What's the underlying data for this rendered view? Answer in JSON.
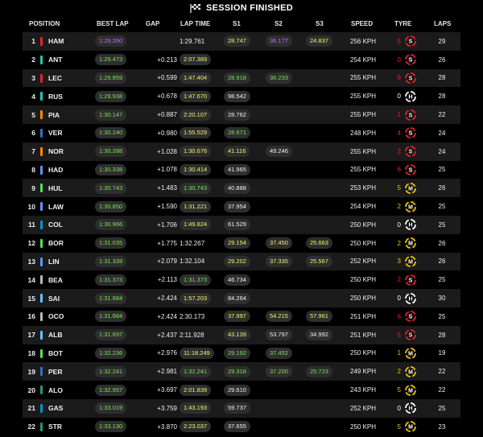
{
  "header": {
    "title": "SESSION FINISHED",
    "icon": "checkered-flag-icon"
  },
  "columns": {
    "position": "POSITION",
    "best_lap": "BEST LAP",
    "gap": "GAP",
    "lap_time": "LAP TIME",
    "s1": "S1",
    "s2": "S2",
    "s3": "S3",
    "speed": "SPEED",
    "tyre": "TYRE",
    "laps": "LAPS"
  },
  "colors": {
    "green": "#7be05a",
    "yellow": "#f3f36b",
    "purple": "#c86cff",
    "white": "#f0f0f0",
    "pill_bg": "#2e2e2e",
    "soft": "#e8202a",
    "medium": "#f2c200",
    "hard": "#ffffff"
  },
  "rows": [
    {
      "pos": "1",
      "driver": "HAM",
      "team_color": "#e8202a",
      "best": "1:29.260",
      "best_c": "purple",
      "gap": "",
      "lap": "1:29.761",
      "lap_c": "white",
      "s1": "28.747",
      "s1_c": "yellow",
      "s2": "36.177",
      "s2_c": "purple",
      "s3": "24.837",
      "s3_c": "yellow",
      "speed": "256 KPH",
      "tyre_age": "5",
      "tyre_age_c": "#e8202a",
      "tyre": "S",
      "laps": "29"
    },
    {
      "pos": "2",
      "driver": "ANT",
      "team_color": "#20c9a9",
      "best": "1:29.473",
      "best_c": "green",
      "gap": "+0.213",
      "lap": "2:07.389",
      "lap_c": "yellow",
      "s1": "",
      "s1_c": "white",
      "s2": "",
      "s2_c": "white",
      "s3": "",
      "s3_c": "white",
      "speed": "254 KPH",
      "tyre_age": "0",
      "tyre_age_c": "#e8202a",
      "tyre": "S",
      "laps": "26"
    },
    {
      "pos": "3",
      "driver": "LEC",
      "team_color": "#e8202a",
      "best": "1:29.859",
      "best_c": "green",
      "gap": "+0.599",
      "lap": "1:47.404",
      "lap_c": "yellow",
      "s1": "28.918",
      "s1_c": "green",
      "s2": "36.233",
      "s2_c": "green",
      "s3": "",
      "s3_c": "white",
      "speed": "255 KPH",
      "tyre_age": "6",
      "tyre_age_c": "#e8202a",
      "tyre": "S",
      "laps": "28"
    },
    {
      "pos": "4",
      "driver": "RUS",
      "team_color": "#20c9a9",
      "best": "1:29.938",
      "best_c": "green",
      "gap": "+0.678",
      "lap": "1:47.670",
      "lap_c": "yellow",
      "s1": "98.542",
      "s1_c": "white",
      "s2": "",
      "s2_c": "white",
      "s3": "",
      "s3_c": "white",
      "speed": "255 KPH",
      "tyre_age": "0",
      "tyre_age_c": "#ffffff",
      "tyre": "H",
      "laps": "28"
    },
    {
      "pos": "5",
      "driver": "PIA",
      "team_color": "#ff8700",
      "best": "1:30.147",
      "best_c": "green",
      "gap": "+0.887",
      "lap": "2:20.107",
      "lap_c": "yellow",
      "s1": "28.762",
      "s1_c": "white",
      "s2": "",
      "s2_c": "white",
      "s3": "",
      "s3_c": "white",
      "speed": "255 KPH",
      "tyre_age": "1",
      "tyre_age_c": "#e8202a",
      "tyre": "S",
      "laps": "22"
    },
    {
      "pos": "6",
      "driver": "VER",
      "team_color": "#3671c6",
      "best": "1:30.240",
      "best_c": "green",
      "gap": "+0.980",
      "lap": "1:55.529",
      "lap_c": "yellow",
      "s1": "28.671",
      "s1_c": "green",
      "s2": "",
      "s2_c": "white",
      "s3": "",
      "s3_c": "white",
      "speed": "248 KPH",
      "tyre_age": "4",
      "tyre_age_c": "#e8202a",
      "tyre": "S",
      "laps": "24"
    },
    {
      "pos": "7",
      "driver": "NOR",
      "team_color": "#ff8700",
      "best": "1:30.288",
      "best_c": "green",
      "gap": "+1.028",
      "lap": "1:30.676",
      "lap_c": "yellow",
      "s1": "41.116",
      "s1_c": "yellow",
      "s2": "49.246",
      "s2_c": "white",
      "s3": "",
      "s3_c": "white",
      "speed": "255 KPH",
      "tyre_age": "2",
      "tyre_age_c": "#e8202a",
      "tyre": "S",
      "laps": "24"
    },
    {
      "pos": "8",
      "driver": "HAD",
      "team_color": "#6692ff",
      "best": "1:30.338",
      "best_c": "green",
      "gap": "+1.078",
      "lap": "1:30.414",
      "lap_c": "yellow",
      "s1": "41.965",
      "s1_c": "white",
      "s2": "",
      "s2_c": "white",
      "s3": "",
      "s3_c": "white",
      "speed": "255 KPH",
      "tyre_age": "6",
      "tyre_age_c": "#e8202a",
      "tyre": "S",
      "laps": "25"
    },
    {
      "pos": "9",
      "driver": "HUL",
      "team_color": "#52e252",
      "best": "1:30.743",
      "best_c": "green",
      "gap": "+1.483",
      "lap": "1:30.743",
      "lap_c": "green",
      "s1": "40.888",
      "s1_c": "white",
      "s2": "",
      "s2_c": "white",
      "s3": "",
      "s3_c": "white",
      "speed": "253 KPH",
      "tyre_age": "5",
      "tyre_age_c": "#f2c200",
      "tyre": "M",
      "laps": "26"
    },
    {
      "pos": "10",
      "driver": "LAW",
      "team_color": "#6692ff",
      "best": "1:30.850",
      "best_c": "green",
      "gap": "+1.590",
      "lap": "1:31.221",
      "lap_c": "yellow",
      "s1": "37.954",
      "s1_c": "white",
      "s2": "",
      "s2_c": "white",
      "s3": "",
      "s3_c": "white",
      "speed": "254 KPH",
      "tyre_age": "2",
      "tyre_age_c": "#f2c200",
      "tyre": "M",
      "laps": "25"
    },
    {
      "pos": "11",
      "driver": "COL",
      "team_color": "#0093cc",
      "best": "1:30.966",
      "best_c": "green",
      "gap": "+1.706",
      "lap": "1:49.824",
      "lap_c": "yellow",
      "s1": "61.529",
      "s1_c": "white",
      "s2": "",
      "s2_c": "white",
      "s3": "",
      "s3_c": "white",
      "speed": "250 KPH",
      "tyre_age": "0",
      "tyre_age_c": "#ffffff",
      "tyre": "H",
      "laps": "25"
    },
    {
      "pos": "12",
      "driver": "BOR",
      "team_color": "#52e252",
      "best": "1:31.035",
      "best_c": "green",
      "gap": "+1.775",
      "lap": "1:32.267",
      "lap_c": "white",
      "s1": "29.154",
      "s1_c": "yellow",
      "s2": "37.450",
      "s2_c": "yellow",
      "s3": "25.663",
      "s3_c": "yellow",
      "speed": "250 KPH",
      "tyre_age": "2",
      "tyre_age_c": "#f2c200",
      "tyre": "M",
      "laps": "26"
    },
    {
      "pos": "13",
      "driver": "LIN",
      "team_color": "#6692ff",
      "best": "1:31.339",
      "best_c": "green",
      "gap": "+2.079",
      "lap": "1:32.104",
      "lap_c": "white",
      "s1": "29.202",
      "s1_c": "yellow",
      "s2": "37.335",
      "s2_c": "yellow",
      "s3": "25.567",
      "s3_c": "yellow",
      "speed": "252 KPH",
      "tyre_age": "3",
      "tyre_age_c": "#f2c200",
      "tyre": "M",
      "laps": "26"
    },
    {
      "pos": "14",
      "driver": "BEA",
      "team_color": "#b6babd",
      "best": "1:31.373",
      "best_c": "green",
      "gap": "+2.113",
      "lap": "1:31.373",
      "lap_c": "green",
      "s1": "46.734",
      "s1_c": "white",
      "s2": "",
      "s2_c": "white",
      "s3": "",
      "s3_c": "white",
      "speed": "250 KPH",
      "tyre_age": "2",
      "tyre_age_c": "#e8202a",
      "tyre": "S",
      "laps": "25"
    },
    {
      "pos": "15",
      "driver": "SAI",
      "team_color": "#64c4ff",
      "best": "1:31.684",
      "best_c": "green",
      "gap": "+2.424",
      "lap": "1:57.203",
      "lap_c": "yellow",
      "s1": "84.264",
      "s1_c": "white",
      "s2": "",
      "s2_c": "white",
      "s3": "",
      "s3_c": "white",
      "speed": "250 KPH",
      "tyre_age": "0",
      "tyre_age_c": "#ffffff",
      "tyre": "H",
      "laps": "30"
    },
    {
      "pos": "16",
      "driver": "OCO",
      "team_color": "#b6babd",
      "best": "1:31.684",
      "best_c": "green",
      "gap": "+2.424",
      "lap": "2:30.173",
      "lap_c": "white",
      "s1": "37.997",
      "s1_c": "yellow",
      "s2": "54.215",
      "s2_c": "yellow",
      "s3": "57.961",
      "s3_c": "yellow",
      "speed": "251 KPH",
      "tyre_age": "6",
      "tyre_age_c": "#e8202a",
      "tyre": "S",
      "laps": "25"
    },
    {
      "pos": "17",
      "driver": "ALB",
      "team_color": "#64c4ff",
      "best": "1:31.697",
      "best_c": "green",
      "gap": "+2.437",
      "lap": "2:11.928",
      "lap_c": "white",
      "s1": "43.139",
      "s1_c": "yellow",
      "s2": "53.797",
      "s2_c": "white",
      "s3": "34.992",
      "s3_c": "white",
      "speed": "251 KPH",
      "tyre_age": "5",
      "tyre_age_c": "#e8202a",
      "tyre": "S",
      "laps": "28"
    },
    {
      "pos": "18",
      "driver": "BOT",
      "team_color": "#52e252",
      "best": "1:32.236",
      "best_c": "green",
      "gap": "+2.976",
      "lap": "11:18.249",
      "lap_c": "yellow",
      "s1": "29.192",
      "s1_c": "green",
      "s2": "37.452",
      "s2_c": "green",
      "s3": "",
      "s3_c": "white",
      "speed": "250 KPH",
      "tyre_age": "1",
      "tyre_age_c": "#f2c200",
      "tyre": "M",
      "laps": "19"
    },
    {
      "pos": "19",
      "driver": "PER",
      "team_color": "#3671c6",
      "best": "1:32.241",
      "best_c": "green",
      "gap": "+2.981",
      "lap": "1:32.241",
      "lap_c": "green",
      "s1": "29.318",
      "s1_c": "green",
      "s2": "37.200",
      "s2_c": "green",
      "s3": "25.723",
      "s3_c": "green",
      "speed": "249 KPH",
      "tyre_age": "2",
      "tyre_age_c": "#f2c200",
      "tyre": "M",
      "laps": "22"
    },
    {
      "pos": "20",
      "driver": "ALO",
      "team_color": "#229971",
      "best": "1:32.957",
      "best_c": "green",
      "gap": "+3.697",
      "lap": "2:01.839",
      "lap_c": "yellow",
      "s1": "29.610",
      "s1_c": "white",
      "s2": "",
      "s2_c": "white",
      "s3": "",
      "s3_c": "white",
      "speed": "243 KPH",
      "tyre_age": "5",
      "tyre_age_c": "#f2c200",
      "tyre": "M",
      "laps": "22"
    },
    {
      "pos": "21",
      "driver": "GAS",
      "team_color": "#0093cc",
      "best": "1:33.019",
      "best_c": "green",
      "gap": "+3.759",
      "lap": "1:43.193",
      "lap_c": "yellow",
      "s1": "59.737",
      "s1_c": "white",
      "s2": "",
      "s2_c": "white",
      "s3": "",
      "s3_c": "white",
      "speed": "252 KPH",
      "tyre_age": "0",
      "tyre_age_c": "#ffffff",
      "tyre": "H",
      "laps": "25"
    },
    {
      "pos": "22",
      "driver": "STR",
      "team_color": "#229971",
      "best": "1:33.130",
      "best_c": "green",
      "gap": "+3.870",
      "lap": "2:23.037",
      "lap_c": "yellow",
      "s1": "37.655",
      "s1_c": "white",
      "s2": "",
      "s2_c": "white",
      "s3": "",
      "s3_c": "white",
      "speed": "250 KPH",
      "tyre_age": "5",
      "tyre_age_c": "#f2c200",
      "tyre": "M",
      "laps": "23"
    }
  ]
}
